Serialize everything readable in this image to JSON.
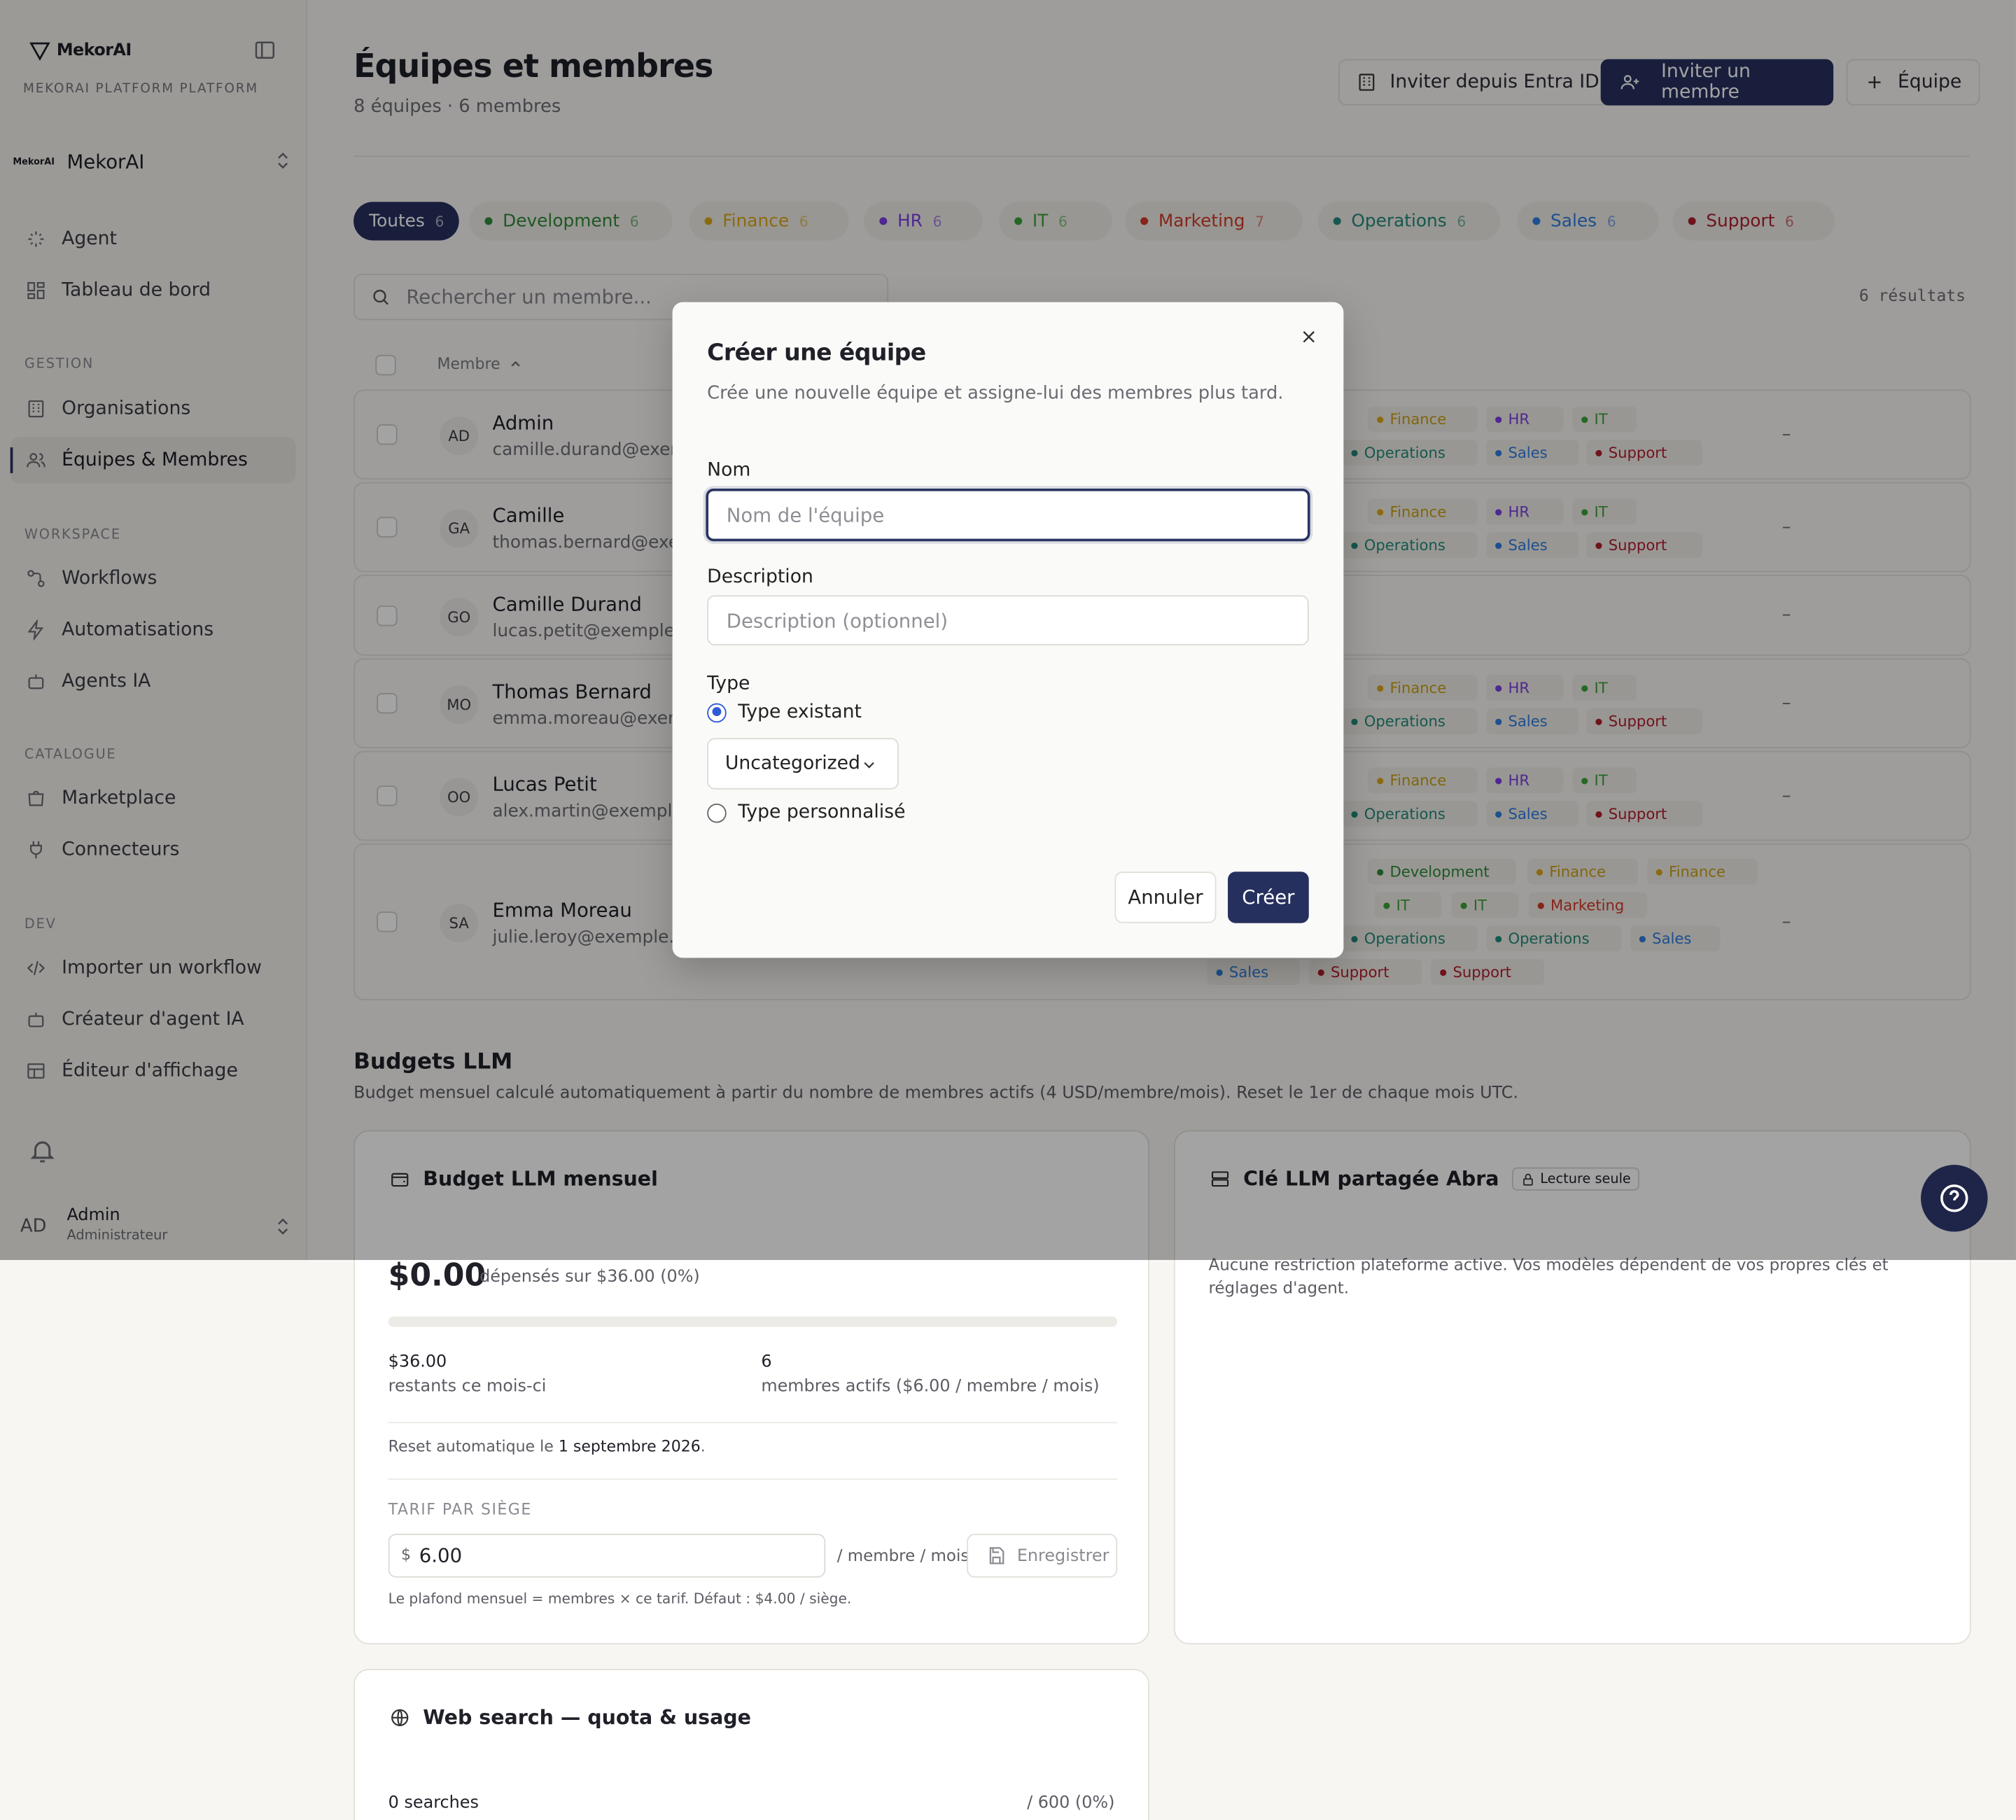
{
  "app": {
    "logo_text": "MekorAI",
    "platform_label": "MEKORAI PLATFORM PLATFORM",
    "org_name": "MekorAI",
    "org_mini": "MekorAI"
  },
  "sidebar": {
    "items_top": [
      {
        "label": "Agent",
        "icon": "sparkle-icon"
      },
      {
        "label": "Tableau de bord",
        "icon": "dashboard-icon"
      }
    ],
    "sections": [
      {
        "title": "GESTION",
        "items": [
          {
            "label": "Organisations",
            "icon": "building-icon"
          },
          {
            "label": "Équipes & Membres",
            "icon": "users-icon",
            "active": true
          }
        ]
      },
      {
        "title": "WORKSPACE",
        "items": [
          {
            "label": "Workflows",
            "icon": "workflow-icon"
          },
          {
            "label": "Automatisations",
            "icon": "bolt-icon"
          },
          {
            "label": "Agents IA",
            "icon": "bot-icon"
          }
        ]
      },
      {
        "title": "CATALOGUE",
        "items": [
          {
            "label": "Marketplace",
            "icon": "store-icon"
          },
          {
            "label": "Connecteurs",
            "icon": "plug-icon"
          }
        ]
      },
      {
        "title": "DEV",
        "items": [
          {
            "label": "Importer un workflow",
            "icon": "code-icon"
          },
          {
            "label": "Créateur d'agent IA",
            "icon": "bot-icon"
          },
          {
            "label": "Éditeur d'affichage",
            "icon": "layout-icon"
          }
        ]
      }
    ],
    "user": {
      "initials": "AD",
      "name": "Admin",
      "role": "Administrateur"
    }
  },
  "header": {
    "title": "Équipes et membres",
    "subtitle": "8 équipes · 6 membres",
    "btn_entra": "Inviter depuis Entra ID",
    "btn_invite": "Inviter un membre",
    "btn_team": "Équipe"
  },
  "filters": [
    {
      "label": "Toutes",
      "count": "6",
      "color": "",
      "active": true
    },
    {
      "label": "Development",
      "count": "6",
      "color": "#2f8a3a"
    },
    {
      "label": "Finance",
      "count": "6",
      "color": "#d9a81a"
    },
    {
      "label": "HR",
      "count": "6",
      "color": "#7b3fe4"
    },
    {
      "label": "IT",
      "count": "6",
      "color": "#3aa33a"
    },
    {
      "label": "Marketing",
      "count": "7",
      "color": "#d23b2b"
    },
    {
      "label": "Operations",
      "count": "6",
      "color": "#218a7a"
    },
    {
      "label": "Sales",
      "count": "6",
      "color": "#2e7de0"
    },
    {
      "label": "Support",
      "count": "6",
      "color": "#b01e2e"
    }
  ],
  "search": {
    "placeholder": "Rechercher un membre...",
    "results": "6 résultats"
  },
  "table": {
    "col_member": "Membre",
    "dash": "–"
  },
  "members": [
    {
      "initials": "AD",
      "name": "Admin",
      "email": "camille.durand@exemp"
    },
    {
      "initials": "GA",
      "name": "Camille",
      "email": "thomas.bernard@exem"
    },
    {
      "initials": "GO",
      "name": "Camille Durand",
      "email": "lucas.petit@exemple.cc"
    },
    {
      "initials": "MO",
      "name": "Thomas Bernard",
      "email": "emma.moreau@exemp"
    },
    {
      "initials": "OO",
      "name": "Lucas Petit",
      "email": "alex.martin@exemple.c"
    },
    {
      "initials": "SA",
      "name": "Emma Moreau",
      "email": "julie.leroy@exemple.cor"
    }
  ],
  "tags": {
    "finance": "Finance",
    "hr": "HR",
    "it": "IT",
    "operations": "Operations",
    "sales": "Sales",
    "support": "Support",
    "development": "Development",
    "marketing": "Marketing"
  },
  "modal": {
    "title": "Créer une équipe",
    "description": "Crée une nouvelle équipe et assigne-lui des membres plus tard.",
    "name_label": "Nom",
    "name_placeholder": "Nom de l'équipe",
    "desc_label": "Description",
    "desc_placeholder": "Description (optionnel)",
    "type_label": "Type",
    "type_existing": "Type existant",
    "type_select": "Uncategorized",
    "type_custom": "Type personnalisé",
    "cancel": "Annuler",
    "create": "Créer"
  },
  "budgets": {
    "title": "Budgets LLM",
    "subtitle": "Budget mensuel calculé automatiquement à partir du nombre de membres actifs (4 USD/membre/mois). Reset le 1er de chaque mois UTC.",
    "monthly": {
      "title": "Budget LLM mensuel",
      "spent": "$0.00",
      "spent_of": "dépensés sur $36.00 (0%)",
      "progress_pct": 0,
      "remaining_value": "$36.00",
      "remaining_label": "restants ce mois-ci",
      "members_value": "6",
      "members_label": "membres actifs ($6.00 / membre / mois)",
      "reset_prefix": "Reset automatique le ",
      "reset_date": "1 septembre 2026",
      "reset_suffix": ".",
      "seat_title": "TARIF PAR SIÈGE",
      "currency": "$",
      "seat_value": "6.00",
      "seat_unit": "/ membre / mois",
      "save": "Enregistrer",
      "note": "Le plafond mensuel = membres × ce tarif. Défaut : $4.00 / siège."
    },
    "shared": {
      "title": "Clé LLM partagée Abra",
      "badge": "Lecture seule",
      "text": "Aucune restriction plateforme active. Vos modèles dépendent de vos propres clés et réglages d'agent."
    },
    "web": {
      "title": "Web search — quota & usage",
      "count": "0 searches",
      "quota": "/ 600 (0%)"
    }
  }
}
